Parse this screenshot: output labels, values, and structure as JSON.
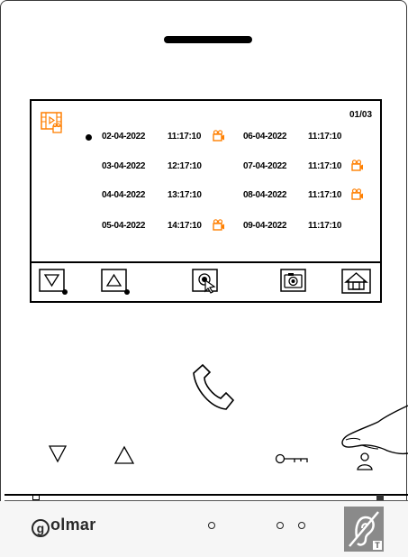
{
  "screen": {
    "page_indicator": "01/03",
    "records": [
      {
        "date": "02-04-2022",
        "time": "11:17:10",
        "has_video": true,
        "selected": true
      },
      {
        "date": "03-04-2022",
        "time": "12:17:10",
        "has_video": false,
        "selected": false
      },
      {
        "date": "04-04-2022",
        "time": "13:17:10",
        "has_video": false,
        "selected": false
      },
      {
        "date": "05-04-2022",
        "time": "14:17:10",
        "has_video": true,
        "selected": false
      },
      {
        "date": "06-04-2022",
        "time": "11:17:10",
        "has_video": false,
        "selected": false
      },
      {
        "date": "07-04-2022",
        "time": "11:17:10",
        "has_video": true,
        "selected": false
      },
      {
        "date": "08-04-2022",
        "time": "11:17:10",
        "has_video": true,
        "selected": false
      },
      {
        "date": "09-04-2022",
        "time": "11:17:10",
        "has_video": false,
        "selected": false
      }
    ],
    "toolbar": [
      "scroll-down-icon",
      "scroll-up-icon",
      "view-record-icon",
      "camera-icon",
      "home-icon"
    ]
  },
  "device": {
    "brand": "golmar",
    "accent_color": "#ff7f00",
    "hardware_buttons": [
      "down-arrow-icon",
      "up-arrow-icon",
      "handset-icon",
      "key-icon",
      "user-icon",
      "hearing-loop-icon"
    ]
  }
}
